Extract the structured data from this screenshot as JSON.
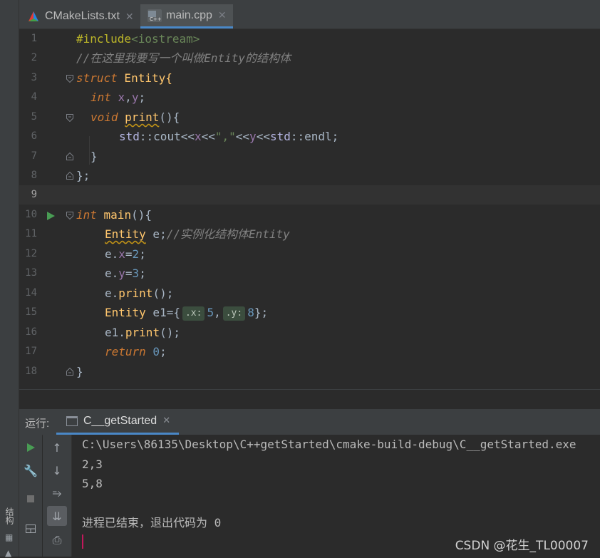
{
  "tabs": [
    {
      "label": "CMakeLists.txt",
      "icon": "cmake-icon",
      "active": false
    },
    {
      "label": "main.cpp",
      "icon": "cpp-file-icon",
      "active": true
    }
  ],
  "editor": {
    "line_numbers": [
      "1",
      "2",
      "3",
      "4",
      "5",
      "6",
      "7",
      "8",
      "9",
      "10",
      "11",
      "12",
      "13",
      "14",
      "15",
      "16",
      "17",
      "18"
    ],
    "current_line": 9,
    "code": {
      "l1_inc": "#include",
      "l1_hdr": "<iostream>",
      "l2_comment": "//在这里我要写一个叫做Entity的结构体",
      "l3_struct": "struct",
      "l3_name": " Entity{",
      "l4_int": "int",
      "l4_x": " x",
      "l4_comma": ",",
      "l4_y": "y",
      "l4_semi": ";",
      "l5_void": "void",
      "l5_sp": " ",
      "l5_print": "print",
      "l5_rest": "(){",
      "l6_std1": "std",
      "l6_cout": "::cout<<",
      "l6_x": "x",
      "l6_op1": "<<",
      "l6_str": "\",\"",
      "l6_op2": "<<",
      "l6_y": "y",
      "l6_op3": "<<",
      "l6_std2": "std",
      "l6_endl": "::endl;",
      "l7": "}",
      "l8": "};",
      "l10_int": "int",
      "l10_main": " main",
      "l10_rest": "(){",
      "l11_type": "Entity",
      "l11_var": " e;",
      "l11_comment": "//实例化结构体Entity",
      "l12_obj": "e.",
      "l12_fld": "x",
      "l12_eq": "=",
      "l12_num": "2",
      "l12_semi": ";",
      "l13_obj": "e.",
      "l13_fld": "y",
      "l13_eq": "=",
      "l13_num": "3",
      "l13_semi": ";",
      "l14_obj": "e.",
      "l14_fn": "print",
      "l14_rest": "();",
      "l15_type": "Entity",
      "l15_var": " e1={",
      "l15_hint_x": ".x:",
      "l15_num1": "5",
      "l15_comma": ",",
      "l15_hint_y": ".y:",
      "l15_num2": "8",
      "l15_end": "};",
      "l16_obj": "e1.",
      "l16_fn": "print",
      "l16_rest": "();",
      "l17_ret": "return",
      "l17_num": " 0",
      "l17_semi": ";",
      "l18": "}"
    }
  },
  "run_panel": {
    "label": "运行:",
    "tab_label": "C__getStarted",
    "output": [
      "C:\\Users\\86135\\Desktop\\C++getStarted\\cmake-build-debug\\C__getStarted.exe",
      "2,3",
      "5,8",
      "",
      "进程已结束，退出代码为 0"
    ]
  },
  "left_strip": {
    "label": "结构"
  },
  "watermark": "CSDN @花生_TL00007",
  "colors": {
    "accent": "#4a88c7",
    "keyword": "#cc7832",
    "string": "#6a8759",
    "number": "#6897bb",
    "field": "#9876aa",
    "run_green": "#499c54"
  }
}
